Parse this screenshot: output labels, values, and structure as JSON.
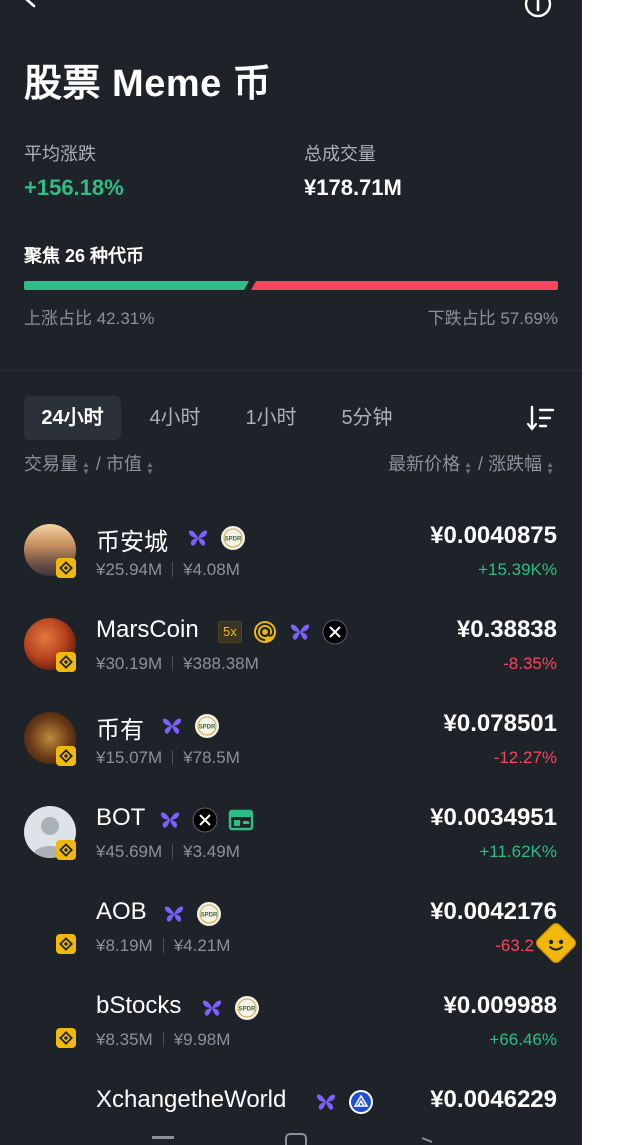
{
  "page": {
    "title": "股票 Meme 币"
  },
  "stats": {
    "avg_change_label": "平均涨跌",
    "avg_change_value": "+156.18%",
    "total_volume_label": "总成交量",
    "total_volume_value": "¥178.71M",
    "focus_label": "聚焦 26 种代币",
    "up_ratio_label": "上涨占比 42.31%",
    "down_ratio_label": "下跌占比 57.69%",
    "up_ratio": 0.4231,
    "down_ratio": 0.5769
  },
  "tabs": [
    {
      "label": "24小时",
      "active": true
    },
    {
      "label": "4小时",
      "active": false
    },
    {
      "label": "1小时",
      "active": false
    },
    {
      "label": "5分钟",
      "active": false
    }
  ],
  "columns": {
    "volume": "交易量",
    "slash1": "/",
    "market_cap": "市值",
    "latest_price": "最新价格",
    "slash2": "/",
    "change": "涨跌幅"
  },
  "coins": [
    {
      "name": "币安城",
      "volume": "¥25.94M",
      "market_cap": "¥4.08M",
      "price": "¥0.0040875",
      "change": "+15.39K%",
      "direction": "up",
      "icons": [
        "butterfly-icon",
        "spdr-icon"
      ]
    },
    {
      "name": "MarsCoin",
      "volume": "¥30.19M",
      "market_cap": "¥388.38M",
      "price": "¥0.38838",
      "change": "-8.35%",
      "direction": "down",
      "badge": "5x",
      "icons": [
        "at-icon",
        "butterfly-icon",
        "x-icon"
      ]
    },
    {
      "name": "币有",
      "volume": "¥15.07M",
      "market_cap": "¥78.5M",
      "price": "¥0.078501",
      "change": "-12.27%",
      "direction": "down",
      "icons": [
        "butterfly-icon",
        "spdr-icon"
      ]
    },
    {
      "name": "BOT",
      "volume": "¥45.69M",
      "market_cap": "¥3.49M",
      "price": "¥0.0034951",
      "change": "+11.62K%",
      "direction": "up",
      "icons": [
        "butterfly-icon",
        "x-icon",
        "exchange-icon"
      ]
    },
    {
      "name": "AOB",
      "volume": "¥8.19M",
      "market_cap": "¥4.21M",
      "price": "¥0.0042176",
      "change": "-63.2",
      "direction": "down",
      "icons": [
        "butterfly-icon",
        "spdr-icon"
      ]
    },
    {
      "name": "bStocks",
      "volume": "¥8.35M",
      "market_cap": "¥9.98M",
      "price": "¥0.009988",
      "change": "+66.46%",
      "direction": "up",
      "icons": [
        "butterfly-icon",
        "spdr-icon"
      ]
    },
    {
      "name": "XchangetheWorld",
      "volume": "",
      "market_cap": "",
      "price": "¥0.0046229",
      "change": "",
      "direction": "",
      "icons": [
        "butterfly-icon",
        "triangle-logo-icon"
      ]
    }
  ],
  "chip_text": {
    "spdr": "SPDR"
  },
  "colors": {
    "background": "#1e2329",
    "up": "#2ebd85",
    "down": "#f6465d",
    "accent_purple": "#7b61ff",
    "bnb_yellow": "#f0b90b"
  }
}
